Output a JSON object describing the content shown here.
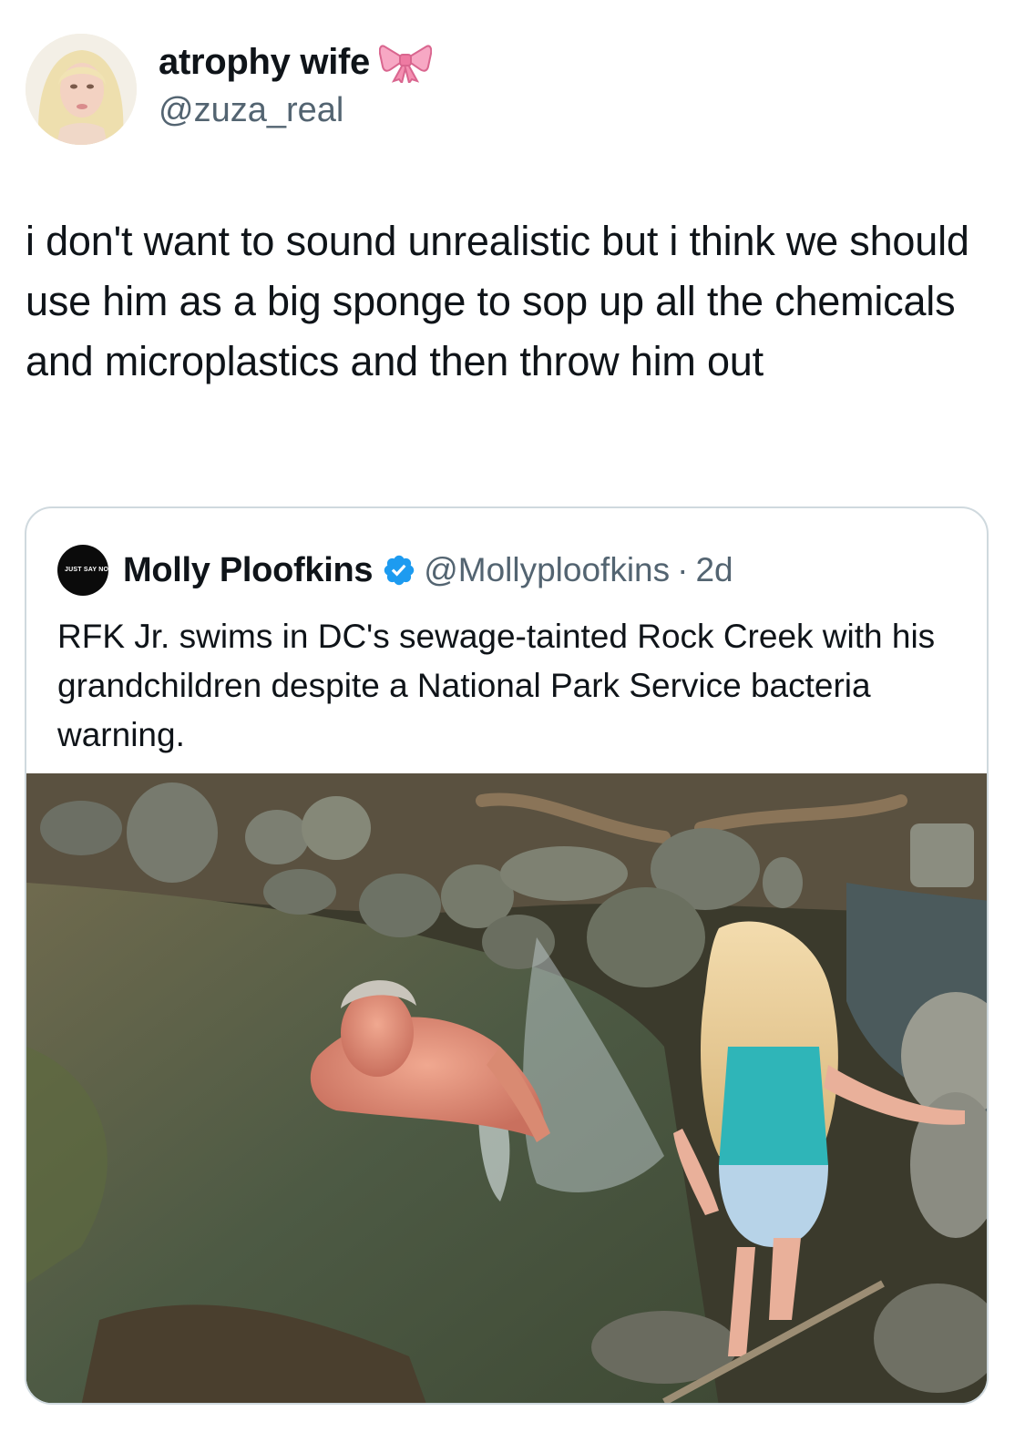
{
  "tweet": {
    "display_name": "atrophy wife",
    "handle": "@zuza_real",
    "name_emoji_icon": "ribbon-bow-icon",
    "text": "i don't want to sound unrealistic but i think we should use him as a big sponge to sop up all the chemicals and microplastics and then throw him out"
  },
  "quote": {
    "avatar_text": "JUST SAY NO TO FASCISM",
    "display_name": "Molly Ploofkins",
    "verified_icon": "verified-badge-icon",
    "handle": "@Mollyploofkins",
    "separator": "·",
    "time": "2d",
    "text": "RFK Jr. swims in DC's sewage-tainted Rock Creek with his grandchildren despite a National Park Service bacteria warning.",
    "photo_alt": "photo"
  },
  "colors": {
    "text_primary": "#0f1419",
    "text_secondary": "#536471",
    "border": "#cfd9de",
    "verified_blue": "#1d9bf0",
    "bow_pink": "#f48fb1"
  }
}
